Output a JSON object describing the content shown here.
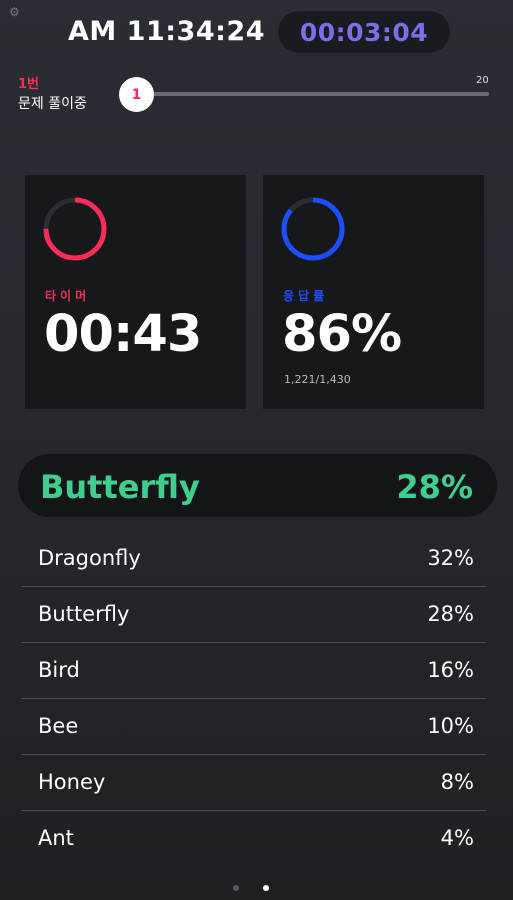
{
  "header": {
    "clock": "AM 11:34:24",
    "elapsed": "00:03:04"
  },
  "question": {
    "number_label": "1번",
    "status": "문제 풀이중",
    "current": "1",
    "max": "20",
    "progress_fraction": 0.05
  },
  "timer_card": {
    "label": "타이머",
    "value": "00:43",
    "ring_color": "#ff2d55",
    "ring_fraction": 0.75
  },
  "rate_card": {
    "label": "응답률",
    "value": "86%",
    "sub": "1,221/1,430",
    "ring_color": "#1e4cff",
    "ring_fraction": 0.86
  },
  "top_answer": {
    "name": "Butterfly",
    "percent": "28%",
    "color": "#3ecf8e"
  },
  "answers": [
    {
      "label": "Dragonfly",
      "percent": "32%"
    },
    {
      "label": "Butterfly",
      "percent": "28%"
    },
    {
      "label": "Bird",
      "percent": "16%"
    },
    {
      "label": "Bee",
      "percent": "10%"
    },
    {
      "label": "Honey",
      "percent": "8%"
    },
    {
      "label": "Ant",
      "percent": "4%"
    }
  ],
  "pager": {
    "count": 2,
    "active_index": 1
  }
}
